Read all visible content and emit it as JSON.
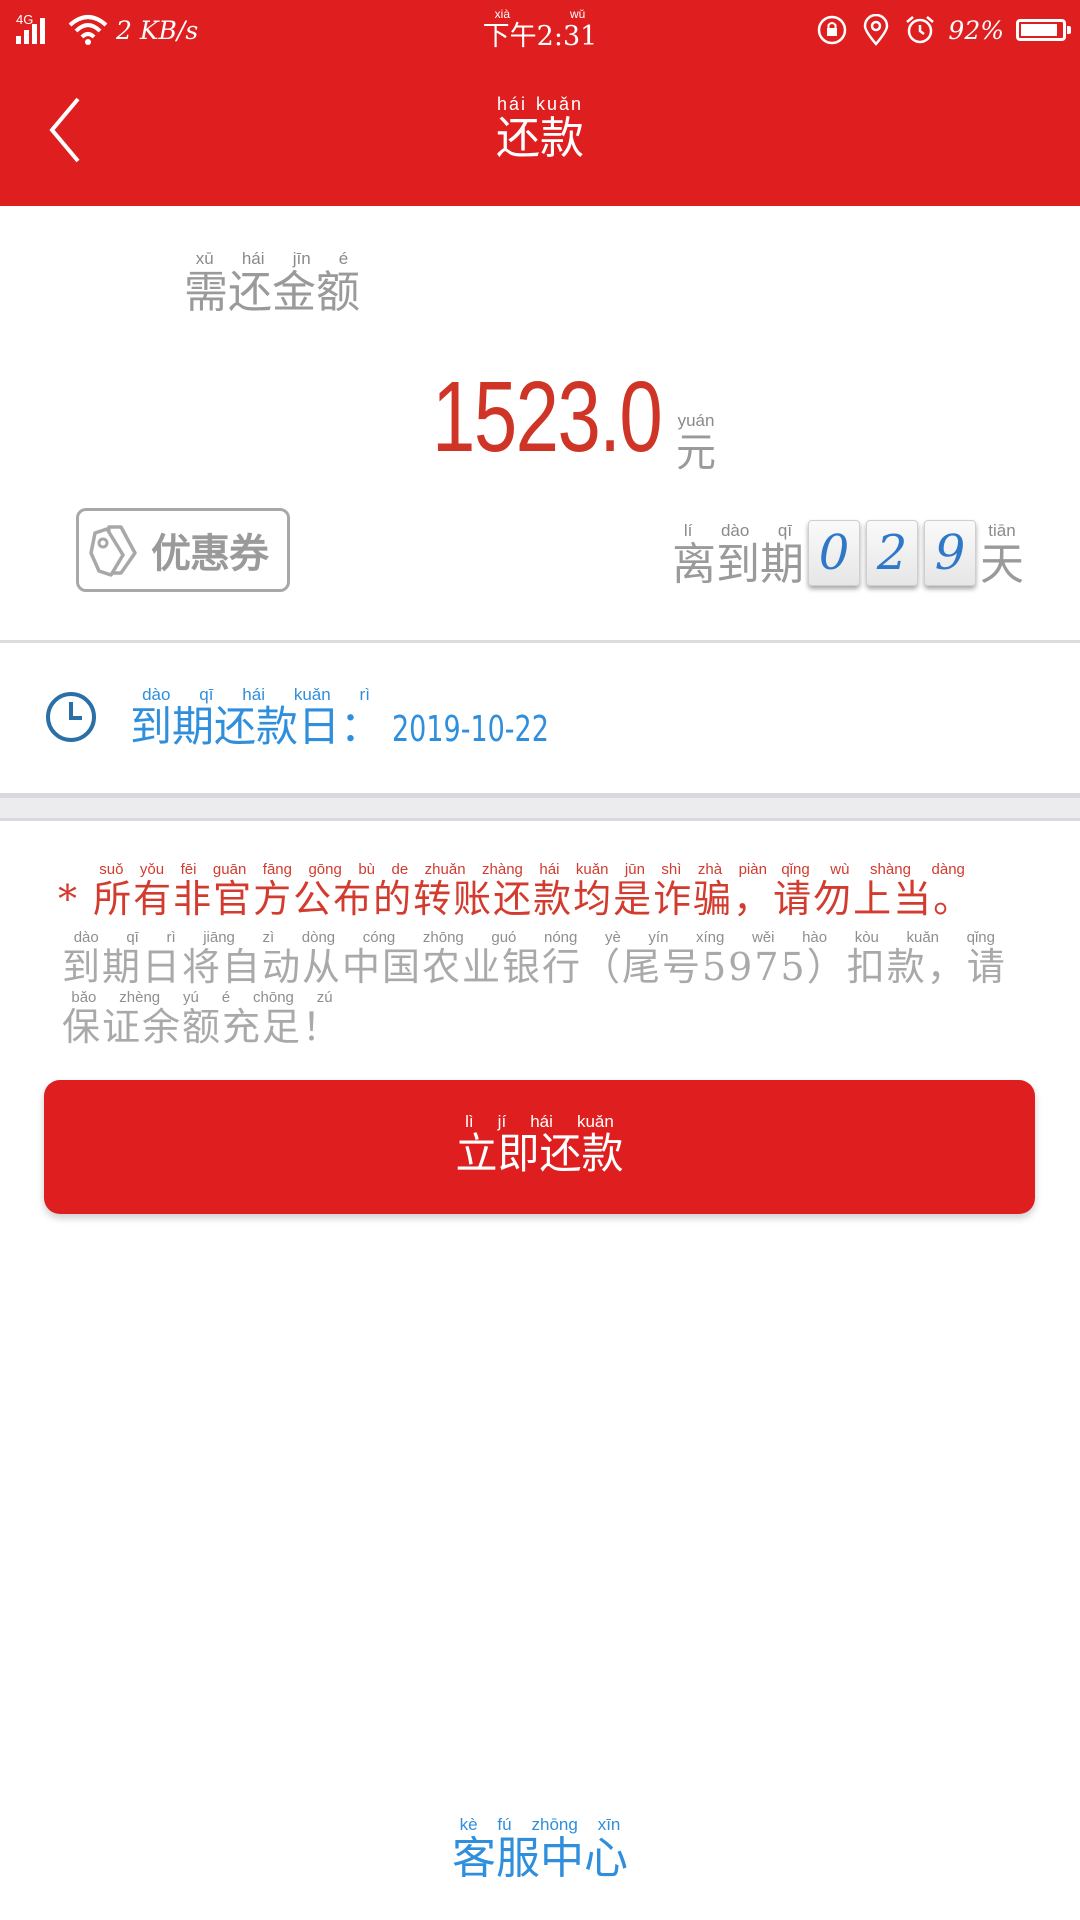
{
  "status_bar": {
    "network": "4G",
    "speed": "2 KB/s",
    "time_pinyin": "xià wǔ",
    "time": "下午2:31",
    "battery_percent": "92%",
    "battery_level": 0.92
  },
  "header": {
    "title_pinyin": "hái kuǎn",
    "title": "还款"
  },
  "amount": {
    "label_pinyin": "xū hái jīn é",
    "label": "需还金额",
    "value": "1523.0",
    "unit_pinyin": "yuán",
    "unit": "元"
  },
  "coupon": {
    "label": "优惠券"
  },
  "countdown": {
    "prefix_pinyin": "lí dào qī",
    "prefix": "离到期",
    "digits": [
      "0",
      "2",
      "9"
    ],
    "suffix_pinyin": "tiān",
    "suffix": "天"
  },
  "due": {
    "label_pinyin": "dào qī hái kuǎn rì",
    "label": "到期还款日：",
    "date": "2019-10-22"
  },
  "warning": {
    "prefix": "*",
    "segments": [
      {
        "text": "所有非官方公布的转账还款均是诈骗，",
        "pinyin": "suǒ yǒu fēi guān fāng gōng bù de zhuǎn zhàng hái kuǎn jūn shì zhà piàn"
      },
      {
        "text": "请勿上当。",
        "pinyin": "qǐng wù shàng dàng"
      }
    ]
  },
  "notice": {
    "line1": "到期日将自动从中国农业银行（尾号5975）扣款，请",
    "line1_pinyin": "dào qī rì jiāng zì dòng cóng zhōng guó nóng yè yín xíng wěi hào kòu kuǎn qǐng",
    "line2": "保证余额充足！",
    "line2_pinyin": "bǎo zhèng yú é chōng zú"
  },
  "repay_button": {
    "label_pinyin": "lì jí hái kuǎn",
    "label": "立即还款"
  },
  "service": {
    "label_pinyin": "kè fú zhōng xīn",
    "label": "客服中心"
  },
  "colors": {
    "brand_red": "#df1f1f",
    "amount_red": "#cf3527",
    "link_blue": "#2f8fdc",
    "muted_gray": "#9a9a9a"
  },
  "icons": [
    "back-arrow-icon",
    "wifi-icon",
    "lock-rotation-icon",
    "location-icon",
    "alarm-icon",
    "battery-icon",
    "coupon-tag-icon",
    "clock-icon"
  ]
}
